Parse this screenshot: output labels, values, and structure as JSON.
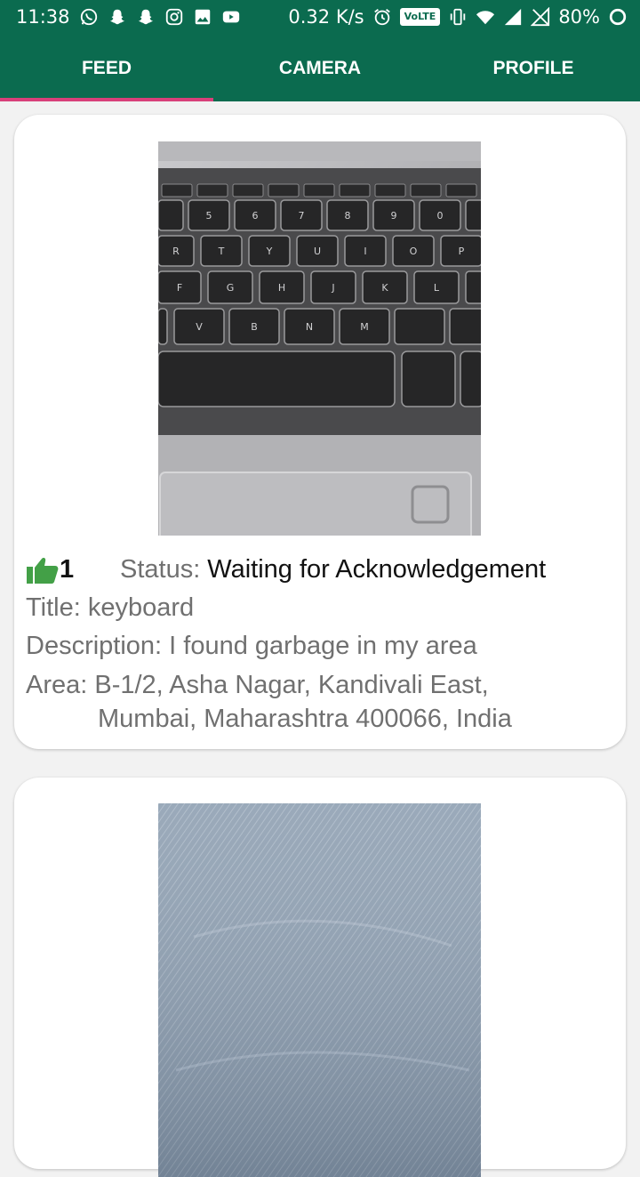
{
  "status_bar": {
    "time": "11:38",
    "net_speed": "0.32 K/s",
    "volte": "VoLTE",
    "battery": "80%",
    "left_icons": [
      "whatsapp-icon",
      "snapchat-icon",
      "snapchat-icon",
      "instagram-icon",
      "gallery-icon",
      "youtube-icon"
    ],
    "right_icons": [
      "alarm-icon",
      "vibrate-icon",
      "wifi-icon",
      "signal-icon",
      "no-sim-icon",
      "battery-ring-icon"
    ]
  },
  "tabs": [
    {
      "label": "FEED",
      "active": true
    },
    {
      "label": "CAMERA",
      "active": false
    },
    {
      "label": "PROFILE",
      "active": false
    }
  ],
  "colors": {
    "primary": "#0b6b4f",
    "accent": "#d8407a",
    "like_green": "#43a047"
  },
  "feed": [
    {
      "image": "keyboard-photo",
      "likes": "1",
      "status_label": "Status:",
      "status_value": "Waiting for Acknowledgement",
      "title": "Title: keyboard",
      "description": "Description: I found garbage in my area",
      "area_line1": "Area: B-1/2, Asha Nagar, Kandivali East,",
      "area_line2": "Mumbai, Maharashtra 400066, India"
    },
    {
      "image": "denim-fabric-photo"
    }
  ]
}
